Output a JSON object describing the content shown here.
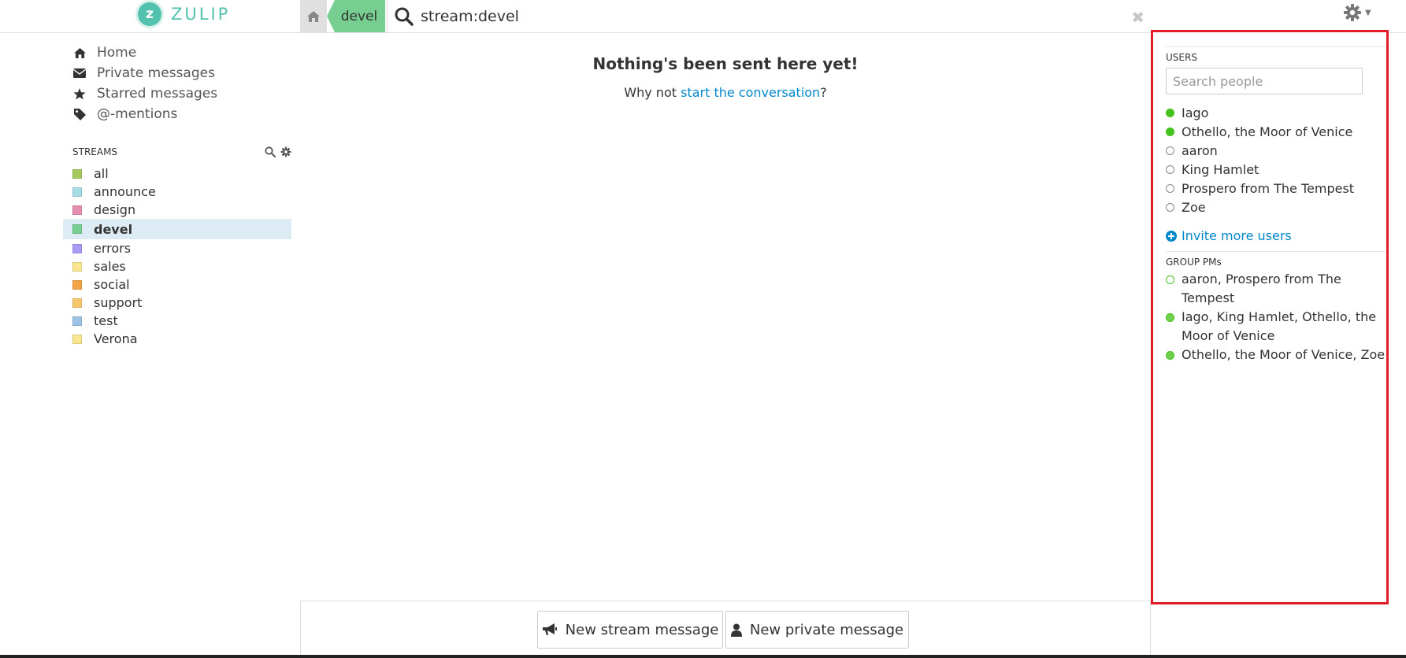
{
  "app": {
    "name": "ZULIP",
    "logo_letter": "z"
  },
  "narrow": {
    "home_icon": "home-icon",
    "stream_label": "devel",
    "search_value": "stream:devel",
    "close_glyph": "✖"
  },
  "left_nav": {
    "items": [
      {
        "label": "Home",
        "icon": "home-icon"
      },
      {
        "label": "Private messages",
        "icon": "envelope-icon"
      },
      {
        "label": "Starred messages",
        "icon": "star-icon"
      },
      {
        "label": "@-mentions",
        "icon": "tag-icon"
      }
    ]
  },
  "streams": {
    "heading": "STREAMS",
    "items": [
      {
        "name": "all",
        "color": "#a6c95e",
        "active": false
      },
      {
        "name": "announce",
        "color": "#a6dce6",
        "active": false
      },
      {
        "name": "design",
        "color": "#e68fb0",
        "active": false
      },
      {
        "name": "devel",
        "color": "#76ce90",
        "active": true
      },
      {
        "name": "errors",
        "color": "#a99cf5",
        "active": false
      },
      {
        "name": "sales",
        "color": "#f9e68f",
        "active": false
      },
      {
        "name": "social",
        "color": "#f2a444",
        "active": false
      },
      {
        "name": "support",
        "color": "#f7c86b",
        "active": false
      },
      {
        "name": "test",
        "color": "#9ec3e6",
        "active": false
      },
      {
        "name": "Verona",
        "color": "#f9e68f",
        "active": false
      }
    ]
  },
  "main": {
    "empty_title": "Nothing's been sent here yet!",
    "empty_prefix": "Why not ",
    "empty_link": "start the conversation",
    "empty_suffix": "?"
  },
  "compose": {
    "stream_button": "New stream message",
    "private_button": "New private message"
  },
  "right_sidebar": {
    "users_heading": "USERS",
    "search_placeholder": "Search people",
    "users": [
      {
        "name": "Iago",
        "status": "active"
      },
      {
        "name": "Othello, the Moor of Venice",
        "status": "active"
      },
      {
        "name": "aaron",
        "status": "idle"
      },
      {
        "name": "King Hamlet",
        "status": "idle"
      },
      {
        "name": "Prospero from The Tempest",
        "status": "idle"
      },
      {
        "name": "Zoe",
        "status": "idle"
      }
    ],
    "invite_label": "Invite more users",
    "group_pms_heading": "GROUP PMs",
    "group_pms": [
      {
        "name": "aaron, Prospero from The Tempest",
        "status": "partial"
      },
      {
        "name": "Iago, King Hamlet, Othello, the Moor of Venice",
        "status": "on"
      },
      {
        "name": "Othello, the Moor of Venice, Zoe",
        "status": "on"
      }
    ]
  },
  "colors": {
    "brand": "#52c2af",
    "link": "#0088cc",
    "active_presence": "#44c21d",
    "highlight_border": "#e21d2a"
  }
}
